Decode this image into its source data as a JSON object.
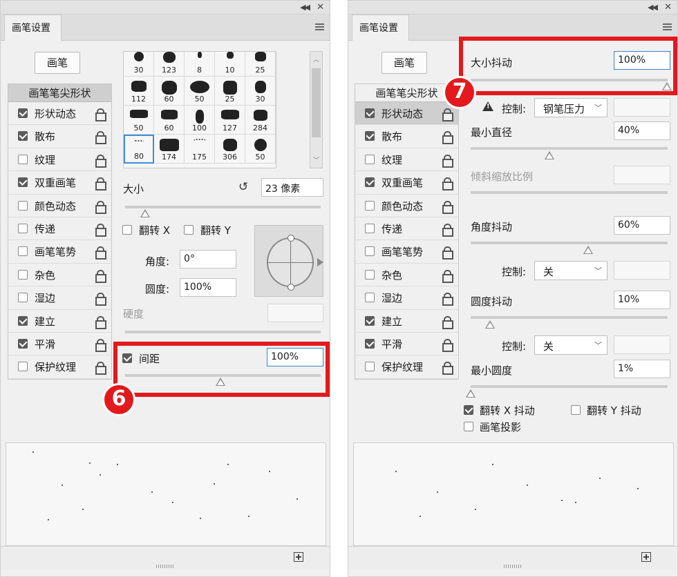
{
  "panel_title": "画笔设置",
  "brush_button": "画笔",
  "sidebar": {
    "header": "画笔笔尖形状",
    "items": [
      {
        "label": "形状动态",
        "checked": true
      },
      {
        "label": "散布",
        "checked": true
      },
      {
        "label": "纹理",
        "checked": false
      },
      {
        "label": "双重画笔",
        "checked": true
      },
      {
        "label": "颜色动态",
        "checked": false
      },
      {
        "label": "传递",
        "checked": false
      },
      {
        "label": "画笔笔势",
        "checked": false
      },
      {
        "label": "杂色",
        "checked": false
      },
      {
        "label": "湿边",
        "checked": false
      },
      {
        "label": "建立",
        "checked": true
      },
      {
        "label": "平滑",
        "checked": true
      },
      {
        "label": "保护纹理",
        "checked": false
      }
    ]
  },
  "left": {
    "tips": [
      "30",
      "123",
      "8",
      "10",
      "25",
      "112",
      "60",
      "50",
      "25",
      "30",
      "50",
      "60",
      "100",
      "127",
      "284",
      "80",
      "174",
      "175",
      "306",
      "50"
    ],
    "size_label": "大小",
    "size_value": "23 像素",
    "flip_x_label": "翻转 X",
    "flip_y_label": "翻转 Y",
    "angle_label": "角度:",
    "angle_value": "0°",
    "roundness_label": "圆度:",
    "roundness_value": "100%",
    "hardness_label": "硬度",
    "spacing_label": "间距",
    "spacing_value": "100%",
    "spacing_checked": true,
    "badge": "6"
  },
  "right": {
    "size_jitter_label": "大小抖动",
    "size_jitter_value": "100%",
    "control_label": "控制:",
    "control1_value": "钢笔压力",
    "min_diameter_label": "最小直径",
    "min_diameter_value": "40%",
    "tilt_scale_label": "倾斜缩放比例",
    "angle_jitter_label": "角度抖动",
    "angle_jitter_value": "60%",
    "control2_value": "关",
    "roundness_jitter_label": "圆度抖动",
    "roundness_jitter_value": "10%",
    "control3_value": "关",
    "min_roundness_label": "最小圆度",
    "min_roundness_value": "1%",
    "flip_x_jitter_label": "翻转 X 抖动",
    "flip_y_jitter_label": "翻转 Y 抖动",
    "brush_projection_label": "画笔投影",
    "badge": "7"
  },
  "icons": [
    "collapse-icon",
    "close-icon",
    "panel-menu-icon",
    "lock-icon",
    "reset-icon",
    "warning-icon",
    "new-brush-icon",
    "resize-grip-icon"
  ],
  "colors": {
    "highlight": "#e3191d",
    "selection": "#3d8fd8",
    "panel_bg": "#f0f0f0"
  }
}
